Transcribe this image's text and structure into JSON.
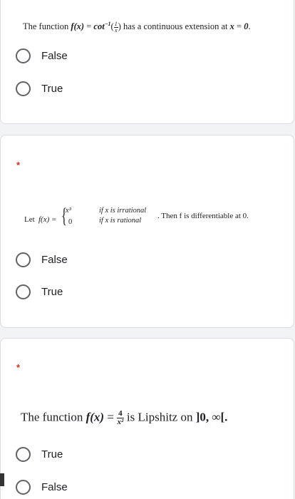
{
  "questions": [
    {
      "required": false,
      "prefix": "The function",
      "fx": "f(x)",
      "eq": "=",
      "func": "cot",
      "power": "−1",
      "frac_num": "1",
      "frac_den": "x",
      "suffix": "has a continuous extension at",
      "var": "x",
      "eq2": "=",
      "point": "0",
      "end": ".",
      "options": [
        "False",
        "True"
      ]
    },
    {
      "required": true,
      "star": "*",
      "let": "Let",
      "fx": "f(x) =",
      "brace": "{",
      "case1_val": "x³",
      "case1_cond": "if x is irrational",
      "case2_val": "0",
      "case2_cond": "if x is rational",
      "rest": ". Then f is differentiable at 0.",
      "options": [
        "False",
        "True"
      ]
    },
    {
      "required": true,
      "star": "*",
      "prefix": "The function",
      "fx": "f(x)",
      "eq": "=",
      "frac_num": "4",
      "frac_den": "x²",
      "suffix": "is Lipshitz on",
      "interval": "]0, ∞[.",
      "options": [
        "True",
        "False"
      ]
    }
  ],
  "colors": {
    "page_bg": "#f1f3f4",
    "card_bg": "#ffffff",
    "required": "#d93025",
    "radio_border": "#5f6368"
  }
}
